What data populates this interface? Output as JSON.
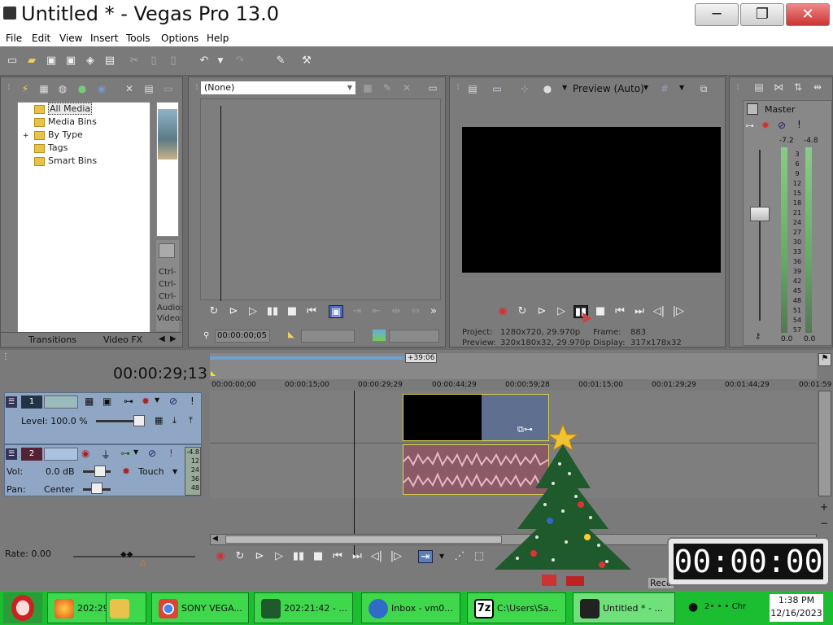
{
  "window": {
    "title": "Untitled * - Vegas Pro 13.0",
    "min": "─",
    "max": "❐",
    "close": "✕"
  },
  "menu": [
    "File",
    "Edit",
    "View",
    "Insert",
    "Tools",
    "Options",
    "Help"
  ],
  "explorer": {
    "tree": [
      "All Media",
      "Media Bins",
      "By Type",
      "Tags",
      "Smart Bins"
    ],
    "expand": "+",
    "tabs": [
      "Transitions",
      "Video FX"
    ],
    "side_text": [
      "Ctrl-",
      "Ctrl-",
      "Ctrl-",
      "Audio:",
      "Video:"
    ]
  },
  "trimmer": {
    "dropdown": "(None)",
    "timecode": "00:00:00;05"
  },
  "preview": {
    "mode": "Preview (Auto)",
    "project_label": "Project:",
    "project_value": "1280x720, 29.970p",
    "preview_label": "Preview:",
    "preview_value": "320x180x32, 29.970p",
    "frame_label": "Frame:",
    "frame_value": "883",
    "display_label": "Display:",
    "display_value": "317x178x32"
  },
  "mixer": {
    "title": "Master",
    "top_l": "-7.2",
    "top_r": "-4.8",
    "scale": [
      "3",
      "6",
      "9",
      "12",
      "15",
      "18",
      "21",
      "24",
      "27",
      "30",
      "33",
      "36",
      "39",
      "42",
      "45",
      "48",
      "51",
      "54",
      "57"
    ],
    "bottom_l": "0.0",
    "bottom_r": "0.0"
  },
  "timeline": {
    "timecode": "00:00:29;13",
    "marker": "+39:06",
    "ruler": [
      "00:00:00;00",
      "00:00:15;00",
      "00:00:29;29",
      "00:00:44;29",
      "00:00:59;28",
      "00:01:15;00",
      "00:01:29;29",
      "00:01:44;29",
      "00:01:59"
    ],
    "track1": {
      "num": "1",
      "level": "Level: 100.0 %"
    },
    "track2": {
      "num": "2",
      "vol_label": "Vol:",
      "vol": "0.0 dB",
      "pan_label": "Pan:",
      "pan": "Center",
      "mode": "Touch",
      "meter": [
        "-4.8",
        "12",
        "24",
        "36",
        "48"
      ]
    },
    "rate": "Rate: 0.00",
    "record": "Reco"
  },
  "overlay_clock": "00:00:00",
  "taskbar": {
    "items": [
      "202:29",
      "",
      "SONY VEGA...",
      "202:21:42 - ...",
      "Inbox - vm0...",
      "C:\\Users\\Sa...",
      "Untitled * - ..."
    ],
    "time": "1:38 PM",
    "date": "12/16/2023",
    "tray": "2• • • Chr"
  },
  "colors": {
    "taskbar": "#1bbd31",
    "track_header": "#8fa6c4",
    "audio_clip": "#8a5b66",
    "video_clip": "#5e6f8f"
  }
}
